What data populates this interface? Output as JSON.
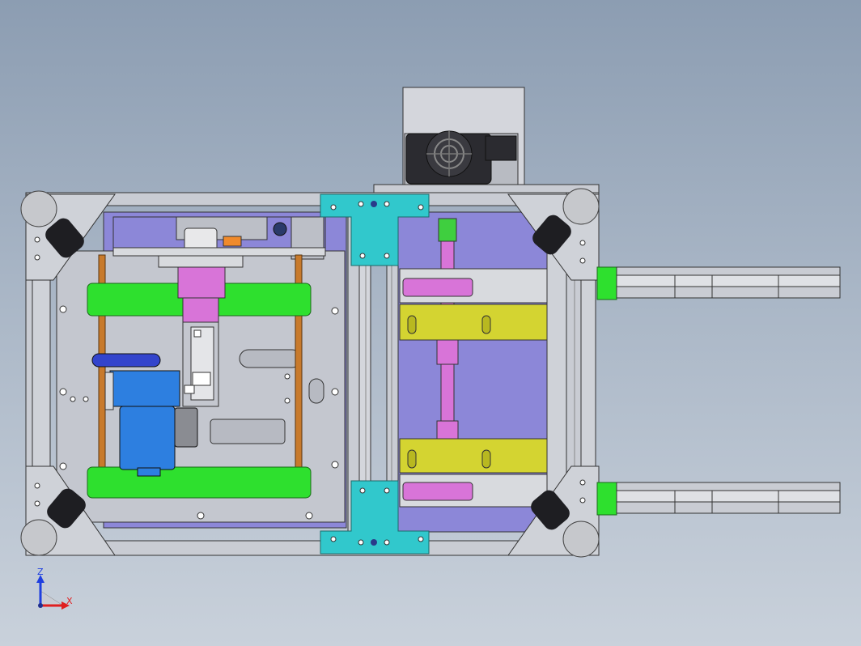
{
  "triad": {
    "z_label": "Z",
    "x_label": "X",
    "z_color": "#1f3fe0",
    "x_color": "#e01f1f"
  },
  "palette": {
    "frame": "#c9ccd3",
    "plate": "#c4c7cf",
    "cyan_bracket": "#31c8cc",
    "green_block": "#2ee02e",
    "magenta_part": "#d874d8",
    "yellow_rail": "#d4d431",
    "blue_motor": "#2d7fe0",
    "purple_back": "#8c87d8",
    "copper_rod": "#c87a2c",
    "dark_wheel": "#1e1e22"
  }
}
